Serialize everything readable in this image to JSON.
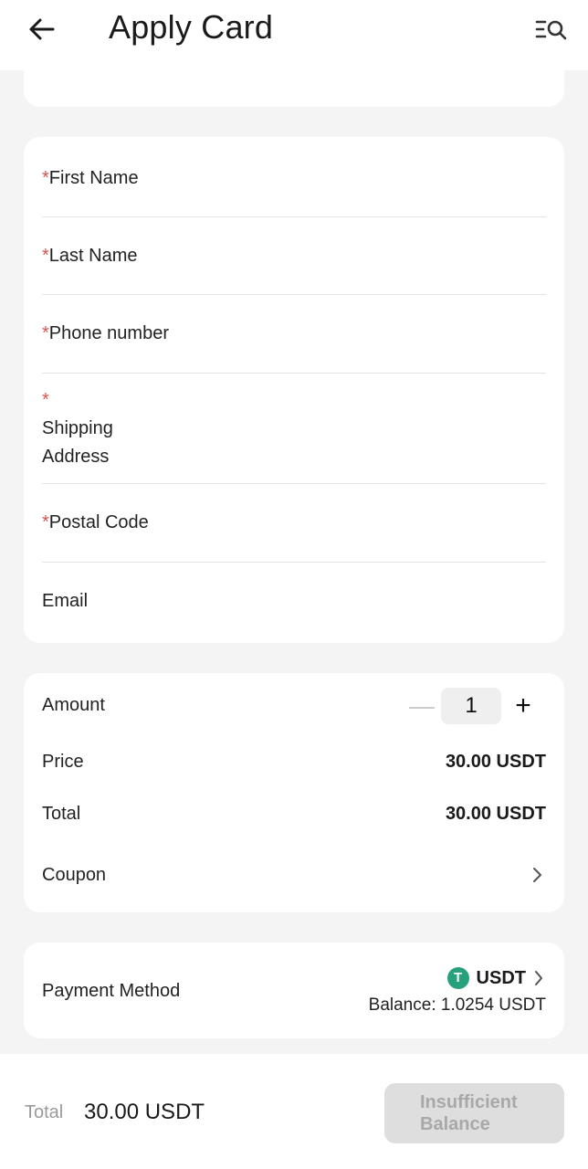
{
  "header": {
    "title": "Apply Card",
    "back_icon": "arrow-left-icon",
    "menu_icon": "list-search-icon"
  },
  "form": {
    "required_mark": "*",
    "first_name": "First Name",
    "last_name": "Last Name",
    "phone": "Phone number",
    "shipping_line1": "Shipping",
    "shipping_line2": "Address",
    "postal_code": "Postal Code",
    "email": "Email"
  },
  "order": {
    "amount_label": "Amount",
    "quantity": "1",
    "minus": "—",
    "plus": "+",
    "price_label": "Price",
    "price_value": "30.00 USDT",
    "total_label": "Total",
    "total_value": "30.00 USDT",
    "coupon_label": "Coupon"
  },
  "payment": {
    "label": "Payment Method",
    "currency": "USDT",
    "currency_logo_letter": "T",
    "balance": "Balance: 1.0254 USDT"
  },
  "footer": {
    "total_label": "Total",
    "total_value": "30.00 USDT",
    "button_line1": "Insufficient",
    "button_line2": "Balance"
  },
  "colors": {
    "required": "#d9534f",
    "usdt": "#26a17b",
    "button_disabled": "#dedede"
  }
}
